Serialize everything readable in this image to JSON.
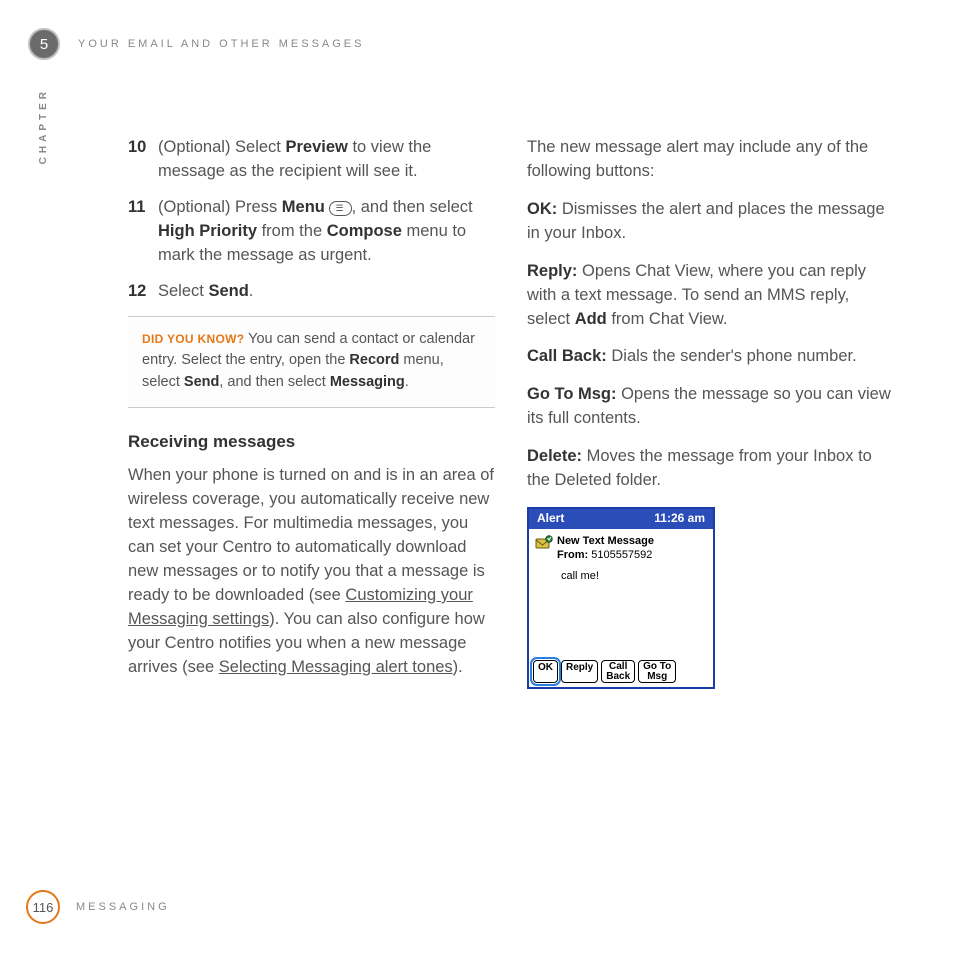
{
  "header": {
    "chapter_number": "5",
    "chapter_label": "CHAPTER",
    "title": "YOUR EMAIL AND OTHER MESSAGES"
  },
  "steps": {
    "s10": {
      "num": "10",
      "prefix": "(Optional)  Select ",
      "bold1": "Preview",
      "suffix": " to view the message as the recipient will see it."
    },
    "s11": {
      "num": "11",
      "prefix": "(Optional)  Press ",
      "bold1": "Menu",
      "mid1": " ",
      "mid2": ", and then select ",
      "bold2": "High Priority",
      "mid3": " from the ",
      "bold3": "Compose",
      "suffix": " menu to mark the message as urgent."
    },
    "s12": {
      "num": "12",
      "prefix": "Select ",
      "bold1": "Send",
      "suffix": "."
    }
  },
  "callout": {
    "label": "DID YOU KNOW?",
    "t1": "  You can send a contact or calendar entry. Select the entry, open the ",
    "b1": "Record",
    "t2": " menu, select ",
    "b2": "Send",
    "t3": ", and then select ",
    "b3": "Messaging",
    "t4": "."
  },
  "receiving": {
    "heading": "Receiving messages",
    "p1a": "When your phone is turned on and is in an area of wireless coverage, you automatically receive new text messages. For multimedia messages, you can set your Centro to automatically download new messages or to notify you that a message is ready to be downloaded (see ",
    "link1": "Customizing your Messaging settings",
    "p1b": "). You can also configure how your Centro notifies you when a new message arrives (see ",
    "link2": "Selecting Messaging alert tones",
    "p1c": ")."
  },
  "intro2": "The new message alert may include any of the following buttons:",
  "defs": {
    "ok": {
      "term": "OK:",
      "text": " Dismisses the alert and places the message in your Inbox."
    },
    "reply": {
      "term": "Reply:",
      "t1": " Opens Chat View, where you can reply with a text message. To send an MMS reply, select ",
      "b1": "Add",
      "t2": " from Chat View."
    },
    "callback": {
      "term": "Call Back:",
      "text": " Dials the sender's phone number."
    },
    "goto": {
      "term": "Go To Msg:",
      "text": " Opens the message so you can view its full contents."
    },
    "delete": {
      "term": "Delete:",
      "text": " Moves the message from your Inbox to the Deleted folder."
    }
  },
  "alert": {
    "title": "Alert",
    "time": "11:26 am",
    "line1": "New Text Message",
    "from_label": "From:",
    "from_value": " 5105557592",
    "body": "call me!",
    "buttons": {
      "ok": "OK",
      "reply": "Reply",
      "callback": "Call\nBack",
      "goto": "Go To\nMsg"
    }
  },
  "footer": {
    "page": "116",
    "section": "MESSAGING"
  }
}
